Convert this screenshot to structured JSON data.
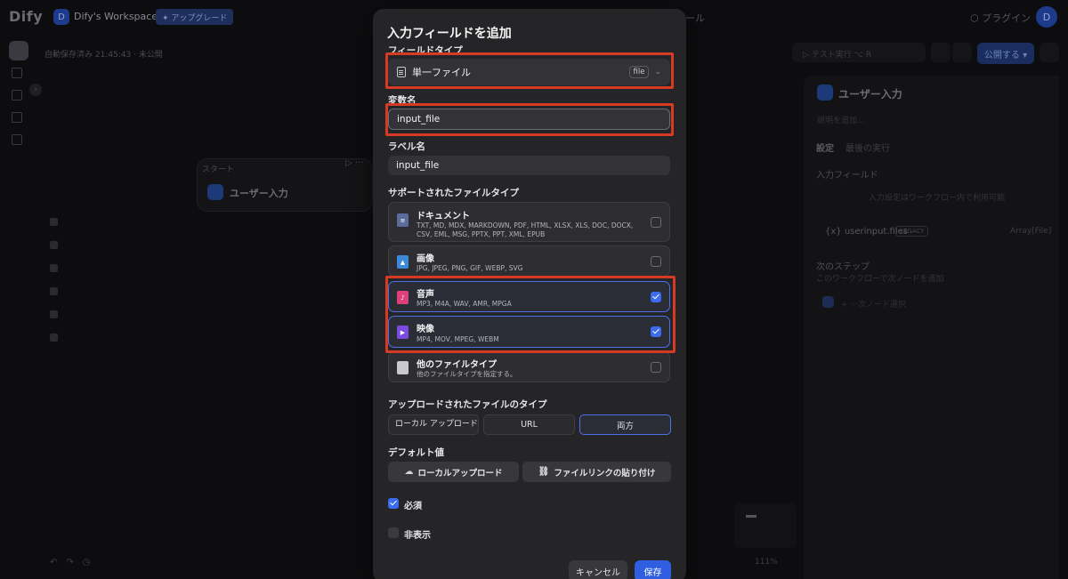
{
  "app": {
    "logo": "Dify",
    "workspace_initial": "D",
    "workspace_name": "Dify's Workspace ▾",
    "upgrade_label": "✦ アップグレード",
    "center_nav": "ール",
    "plugin_label": "⬡ プラグイン",
    "user_initial": "D",
    "autosave": "自動保存済み 21:45:43 · 未公開",
    "run_test": "▷ テスト実行 ⌥ R",
    "publish_label": "公開する ▾",
    "zoom": "111%"
  },
  "canvas": {
    "start_label": "スタート",
    "start_node_title": "ユーザー入力",
    "start_dots": "▷ ···"
  },
  "right_panel": {
    "title": "ユーザー入力",
    "description_placeholder": "説明を追加...",
    "tab_settings": "設定",
    "tab_last_run": "最後の実行",
    "input_fields_heading": "入力フィールド",
    "input_fields_hint": "入力設定はワークフロー内で利用可能",
    "var_name": "{x} userinput.files",
    "var_badge": "LEGACY",
    "var_type": "Array[File]",
    "next_step_heading": "次のステップ",
    "next_step_hint": "このワークフローで次ノードを追加",
    "next_node_placeholder": "+ ···次ノード選択"
  },
  "modal": {
    "title": "入力フィールドを追加",
    "field_type_label": "フィールドタイプ",
    "field_type_value": "単一ファイル",
    "field_type_badge": "file",
    "var_name_label": "変数名",
    "var_name_value": "input_file",
    "label_name_label": "ラベル名",
    "label_name_value": "input_file",
    "supported_types_label": "サポートされたファイルタイプ",
    "file_types": [
      {
        "name": "ドキュメント",
        "exts": "TXT, MD, MDX, MARKDOWN, PDF, HTML, XLSX, XLS, DOC, DOCX, CSV, EML, MSG, PPTX, PPT, XML, EPUB",
        "checked": false
      },
      {
        "name": "画像",
        "exts": "JPG, JPEG, PNG, GIF, WEBP, SVG",
        "checked": false
      },
      {
        "name": "音声",
        "exts": "MP3, M4A, WAV, AMR, MPGA",
        "checked": true
      },
      {
        "name": "映像",
        "exts": "MP4, MOV, MPEG, WEBM",
        "checked": true
      },
      {
        "name": "他のファイルタイプ",
        "exts": "他のファイルタイプを指定する。",
        "checked": false
      }
    ],
    "upload_type_label": "アップロードされたファイルのタイプ",
    "upload_options": [
      "ローカル アップロード",
      "URL",
      "両方"
    ],
    "upload_selected": "両方",
    "default_value_label": "デフォルト値",
    "local_upload_button": "ローカルアップロード",
    "paste_link_button": "ファイルリンクの貼り付け",
    "required_label": "必須",
    "required_checked": true,
    "hidden_label": "非表示",
    "hidden_checked": false,
    "cancel_label": "キャンセル",
    "save_label": "保存"
  },
  "colors": {
    "accent_blue": "#3b6cf0",
    "highlight_red": "#d63a25",
    "audio_icon": "#e0407a",
    "video_icon": "#7b4be0",
    "document_icon": "#5b6b9a",
    "image_icon": "#3a8ad8"
  }
}
